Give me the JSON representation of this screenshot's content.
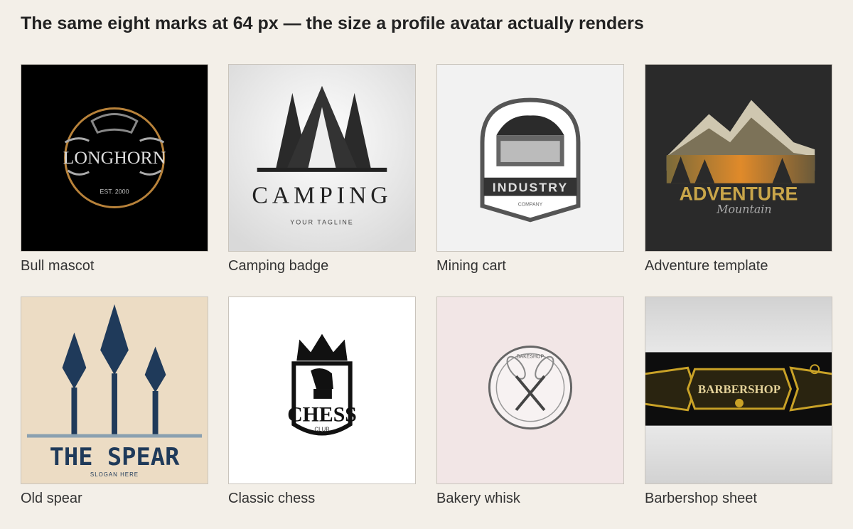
{
  "header": {
    "title": "The same eight marks at 64 px — the size a profile avatar actually renders"
  },
  "tiles": [
    {
      "caption": "Bull mascot",
      "logo_text": "LONGHORN",
      "sub_text": "EST. 2000",
      "bg": "#000000",
      "accent": "#b8823a"
    },
    {
      "caption": "Camping badge",
      "logo_text": "CAMPING",
      "sub_text": "YOUR TAGLINE",
      "bg": "#eeeeee",
      "accent": "#222222"
    },
    {
      "caption": "Mining cart",
      "logo_text": "INDUSTRY",
      "sub_text": "COMPANY",
      "bg": "#f2f2f2",
      "accent": "#3a3a3a"
    },
    {
      "caption": "Adventure template",
      "logo_text": "ADVENTURE",
      "sub_text": "Mountain",
      "bg": "#2a2a2a",
      "accent": "#d9a03a"
    },
    {
      "caption": "Old spear",
      "logo_text": "THE SPEAR",
      "sub_text": "SLOGAN HERE",
      "bg": "#ecdcc4",
      "accent": "#1f3a5a"
    },
    {
      "caption": "Classic chess",
      "logo_text": "CHESS",
      "sub_text": "CLUB",
      "bg": "#ffffff",
      "accent": "#111111"
    },
    {
      "caption": "Bakery whisk",
      "logo_text": "BAKESHOP",
      "sub_text": "",
      "bg": "#f2e6e6",
      "accent": "#555555"
    },
    {
      "caption": "Barbershop sheet",
      "logo_text": "BARBERSHOP",
      "sub_text": "",
      "bg": "#e4e4e4",
      "accent": "#c9a227"
    }
  ]
}
